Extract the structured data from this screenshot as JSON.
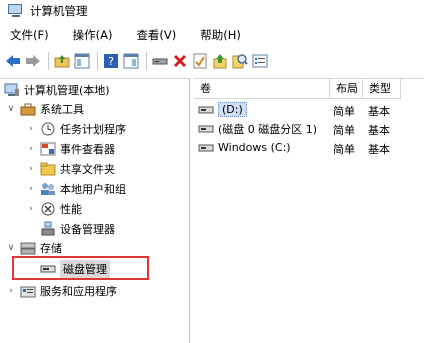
{
  "window": {
    "title": "计算机管理"
  },
  "menu": [
    "文件(F)",
    "操作(A)",
    "查看(V)",
    "帮助(H)"
  ],
  "tree": {
    "root": "计算机管理(本地)",
    "system_tools": "系统工具",
    "task_scheduler": "任务计划程序",
    "event_viewer": "事件查看器",
    "shared_folders": "共享文件夹",
    "local_users": "本地用户和组",
    "performance": "性能",
    "device_manager": "设备管理器",
    "storage": "存储",
    "disk_management": "磁盘管理",
    "services_apps": "服务和应用程序"
  },
  "list": {
    "columns": [
      "卷",
      "布局",
      "类型"
    ],
    "rows": [
      {
        "volume": "(D:)",
        "layout": "简单",
        "type": "基本"
      },
      {
        "volume": "(磁盘 0 磁盘分区 1)",
        "layout": "简单",
        "type": "基本"
      },
      {
        "volume": "Windows (C:)",
        "layout": "简单",
        "type": "基本"
      }
    ]
  },
  "colors": {
    "highlight": "#e03434",
    "selection": "#cfe0f6"
  }
}
